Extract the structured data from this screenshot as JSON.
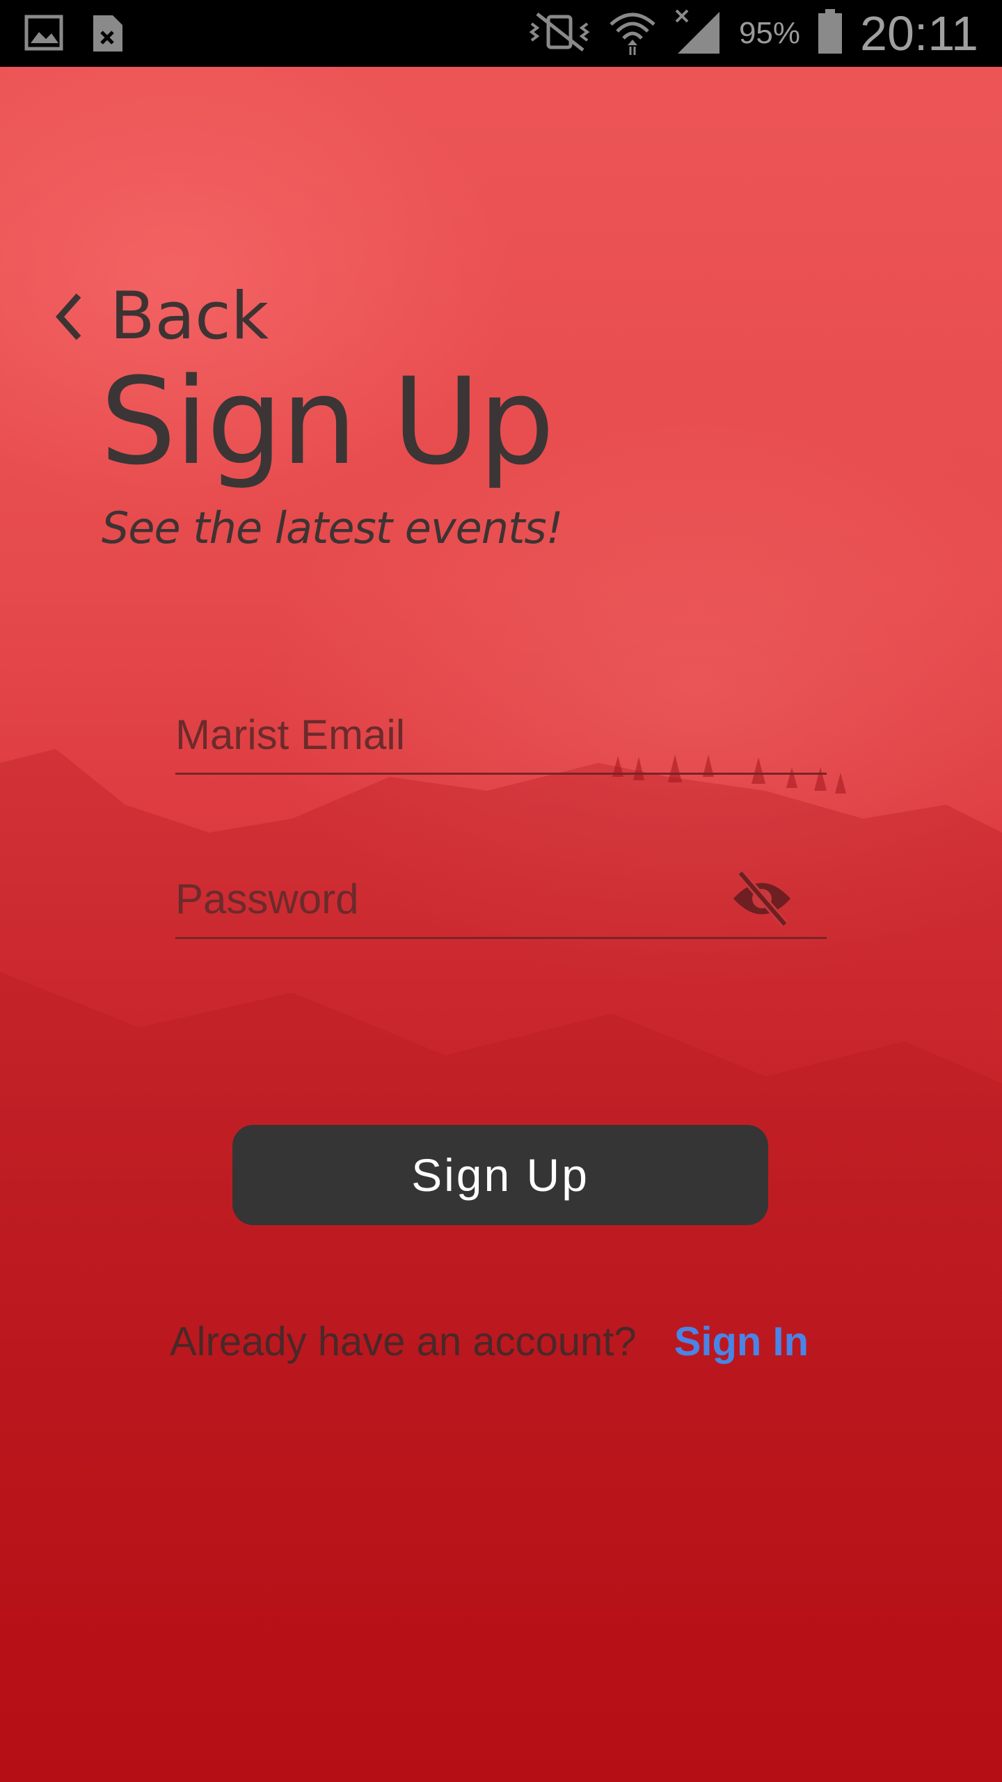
{
  "status_bar": {
    "left_icons": [
      "image-icon",
      "file-x-icon"
    ],
    "right_icons": [
      "vibrate-mute-icon",
      "wifi-icon",
      "no-signal-icon",
      "battery-icon"
    ],
    "battery_percent": "95%",
    "time": "20:11"
  },
  "nav": {
    "back_label": "Back",
    "back_icon": "chevron-left-icon"
  },
  "header": {
    "title": "Sign Up",
    "subtitle": "See the latest events!"
  },
  "form": {
    "email": {
      "placeholder": "Marist Email",
      "value": ""
    },
    "password": {
      "placeholder": "Password",
      "value": "",
      "toggle_icon": "eye-off-icon"
    },
    "submit_label": "Sign Up"
  },
  "footer": {
    "prompt": "Already have an account?",
    "link_label": "Sign In"
  },
  "colors": {
    "background_top": "#ec5556",
    "background_bottom": "#bf0f16",
    "button": "#353535",
    "link": "#4a84e6"
  }
}
